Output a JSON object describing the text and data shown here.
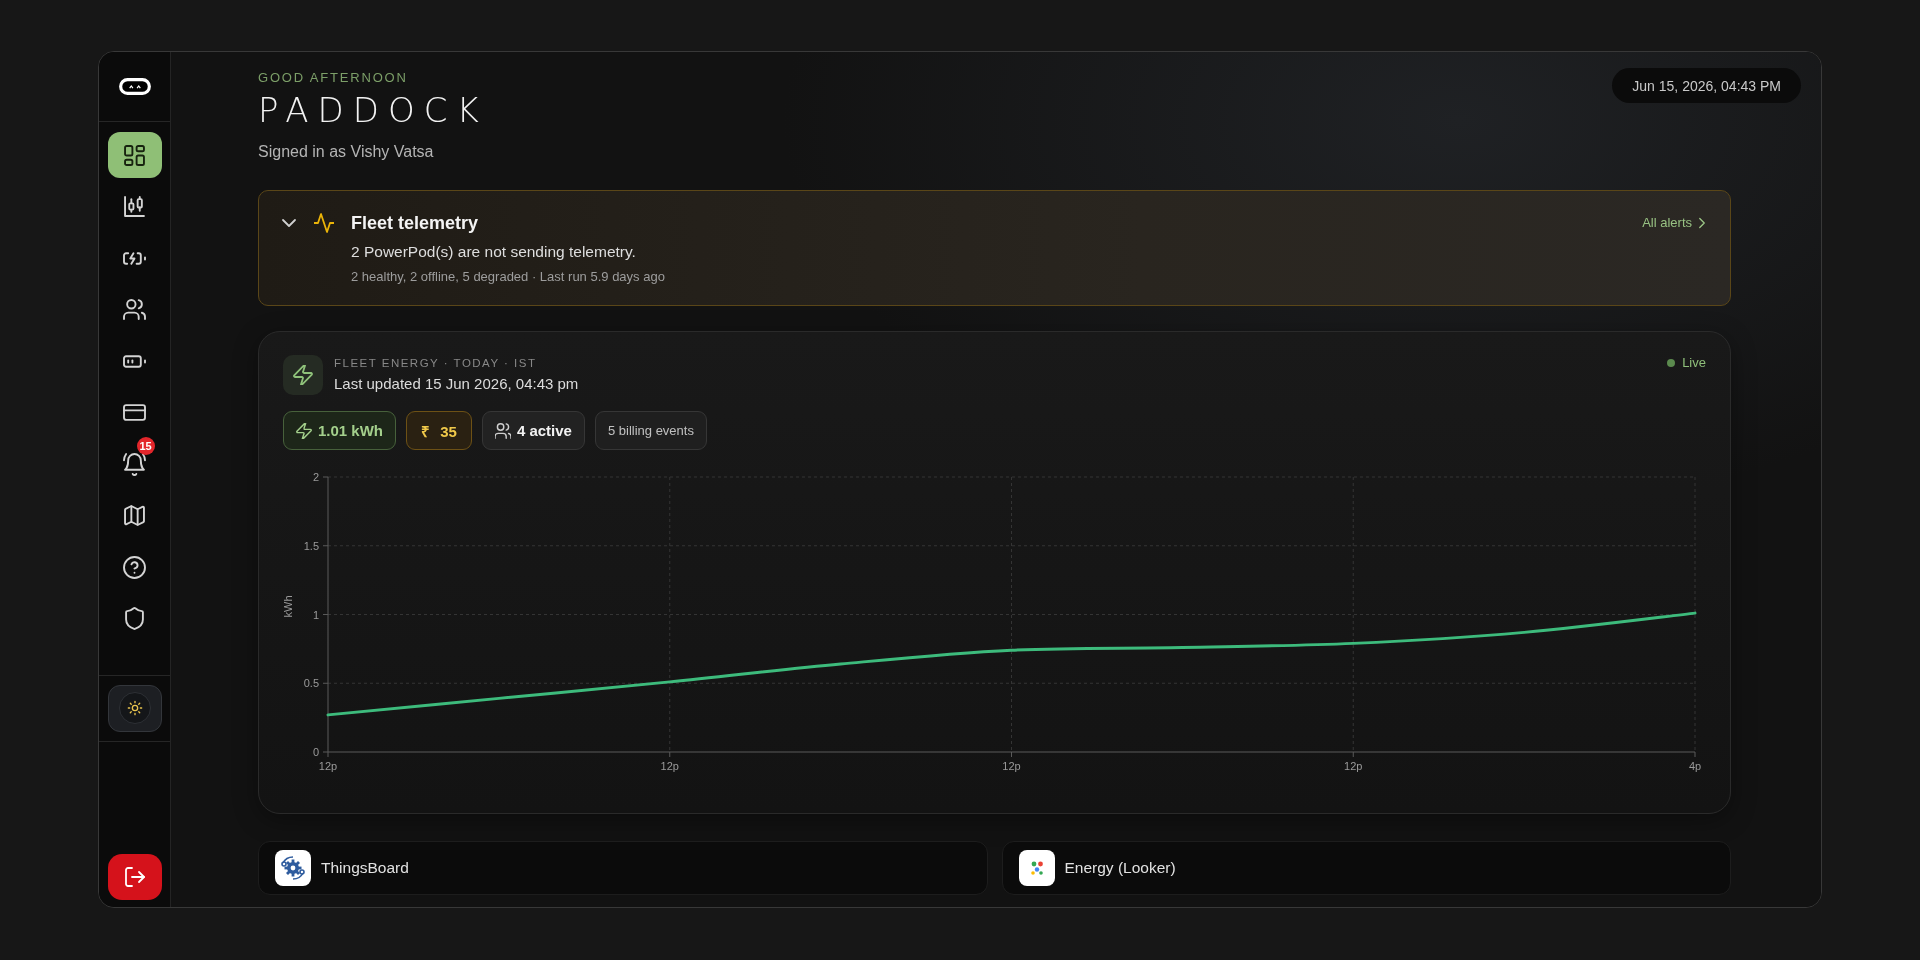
{
  "sidebar": {
    "nav_items": [
      {
        "selected": true
      },
      {
        "selected": false
      },
      {
        "selected": false
      },
      {
        "selected": false
      },
      {
        "selected": false
      },
      {
        "selected": false
      },
      {
        "selected": false,
        "badge": "15"
      },
      {
        "selected": false
      },
      {
        "selected": false
      },
      {
        "selected": false
      }
    ]
  },
  "header": {
    "greeting": "GOOD AFTERNOON",
    "title": "PADDOCK",
    "signed_in": "Signed in as Vishy Vatsa",
    "datetime": "Jun 15, 2026, 04:43 PM"
  },
  "alert": {
    "expanded": true,
    "title": "Fleet telemetry",
    "message": "2 PowerPod(s) are not sending telemetry.",
    "details": "2 healthy, 2 offline, 5 degraded · Last run 5.9 days ago",
    "link": "All alerts"
  },
  "energy": {
    "label": "FLEET ENERGY · TODAY · IST",
    "updated": "Last updated 15 Jun 2026, 04:43 pm",
    "status": "Live",
    "chips": [
      {
        "kind": "energy",
        "text": "1.01 kWh"
      },
      {
        "kind": "cost",
        "text": "₹ 35"
      },
      {
        "kind": "users",
        "text": "4 active"
      },
      {
        "kind": "plain",
        "text": "5 billing events"
      }
    ],
    "chart_data": {
      "type": "line",
      "ylabel": "kWh",
      "categories": [
        "12p",
        null,
        "12p",
        null,
        "12p",
        null,
        "12p",
        null,
        "4p"
      ],
      "series": [
        {
          "color": "#3dbb7c",
          "values": [
            0.27,
            0.39,
            0.51,
            0.64,
            0.74,
            0.76,
            0.79,
            0.87,
            1.01
          ]
        }
      ],
      "ylim": [
        0,
        2
      ],
      "yticks": [
        0,
        0.5,
        1,
        1.5,
        2
      ],
      "grid": true
    }
  },
  "integrations": [
    {
      "name": "ThingsBoard"
    },
    {
      "name": "Energy (Looker)"
    }
  ]
}
